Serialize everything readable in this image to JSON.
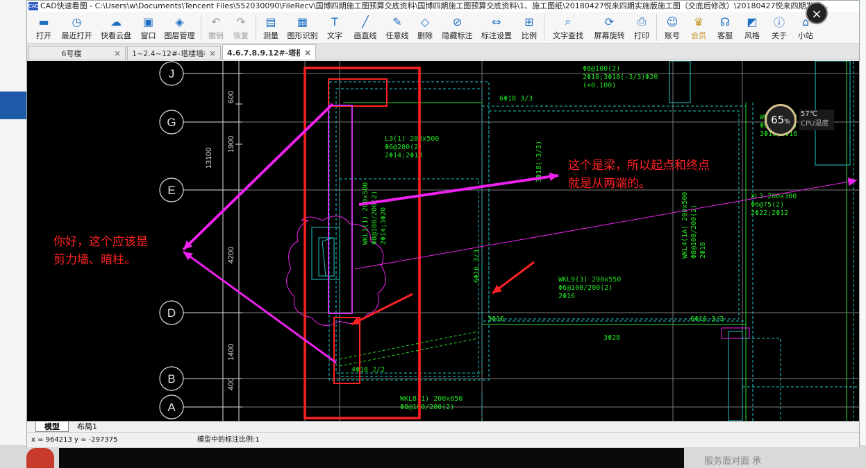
{
  "window": {
    "title": "CAD快速看图 - C:\\Users\\w\\Documents\\Tencent Files\\552030090\\FileRecv\\国博四期施工图预算交底资料\\国博四期施工图预算交底资料\\1、施工图纸\\20180427悦来四期实施版施工图（交底后修改）\\20180427悦来四期发成...",
    "app_icon": "CAD"
  },
  "toolbar": {
    "items": [
      {
        "label": "打开",
        "icon": "folder-open-icon"
      },
      {
        "label": "最近打开",
        "icon": "clock-icon"
      },
      {
        "label": "快看云盘",
        "icon": "cloud-icon"
      },
      {
        "label": "窗口",
        "icon": "window-icon"
      },
      {
        "label": "图层管理",
        "icon": "layers-icon"
      },
      {
        "label": "撤销",
        "icon": "undo-icon",
        "disabled": true
      },
      {
        "label": "恢复",
        "icon": "redo-icon",
        "disabled": true
      },
      {
        "label": "测量",
        "icon": "ruler-icon"
      },
      {
        "label": "图形识别",
        "icon": "shape-recognize-icon"
      },
      {
        "label": "文字",
        "icon": "text-icon"
      },
      {
        "label": "画直线",
        "icon": "line-icon"
      },
      {
        "label": "任意线",
        "icon": "pen-icon"
      },
      {
        "label": "删除",
        "icon": "eraser-icon"
      },
      {
        "label": "隐藏标注",
        "icon": "eye-hide-icon"
      },
      {
        "label": "标注设置",
        "icon": "dimension-settings-icon"
      },
      {
        "label": "比例",
        "icon": "scale-icon"
      },
      {
        "label": "文字查找",
        "icon": "text-search-icon"
      },
      {
        "label": "屏幕旋转",
        "icon": "rotate-screen-icon"
      },
      {
        "label": "打印",
        "icon": "printer-icon"
      },
      {
        "label": "账号",
        "icon": "user-icon"
      },
      {
        "label": "会员",
        "icon": "vip-icon",
        "vip": true
      },
      {
        "label": "客服",
        "icon": "headset-icon"
      },
      {
        "label": "风格",
        "icon": "style-icon"
      },
      {
        "label": "关于",
        "icon": "info-icon"
      },
      {
        "label": "小站",
        "icon": "station-icon"
      }
    ]
  },
  "tabs": [
    {
      "label": "6号楼",
      "active": false
    },
    {
      "label": "1~2.4~12#-塔楼墙柱…",
      "active": false
    },
    {
      "label": "4.6.7.8.9.12#-塔楼…",
      "active": true
    }
  ],
  "close_glyph": "×",
  "tab_close_glyph": "×",
  "drawing": {
    "grid_labels": [
      "J",
      "G",
      "E",
      "D",
      "B",
      "A"
    ],
    "dims": [
      "600",
      "1900",
      "13100",
      "4200",
      "1400",
      "400"
    ],
    "beam_texts": [
      "L3(1) 200x500",
      "Φ6@200(2)",
      "2Φ14;2Φ18",
      "WKL1(1) 200x500",
      "Φ8@100/200(2)",
      "2Φ14;3Φ20",
      "WKL4(1A) 200x500",
      "Φ8@100/200(2)",
      "2Φ18",
      "WKL9(3) 200x550",
      "Φ6@100/200(2)",
      "2Φ16",
      "WKL8(1) 200x650",
      "Φ8@100/200(2)",
      "XL3 200x300",
      "Φ6@75(2)",
      "2Φ22;2Φ12",
      "WKL1(1) 2",
      "Φ8@100(2)",
      "3Φ16;3Φ16",
      "6Φ18 3/3",
      "6Φ16 3/3",
      "3Φ16",
      "3Φ28",
      "6Φ16 3/3",
      "4Φ18 2/2",
      "3Φ18(-3/3)",
      "Φ8@100(2)",
      "2Φ18;3Φ18(-3/3)Φ20",
      "(+0.100)"
    ],
    "annotations": [
      {
        "text_lines": [
          "你好，这个应该是",
          "剪力墙、暗柱。"
        ]
      },
      {
        "text_lines": [
          "这个是梁，所以起点和终点",
          "就是从两端的。"
        ]
      }
    ]
  },
  "layout_tabs": [
    {
      "label": "模型",
      "active": true
    },
    {
      "label": "布局1",
      "active": false
    }
  ],
  "status": {
    "coords": "x = 964213  y = -297375",
    "scale": "模型中的标注比例:1"
  },
  "cpu_widget": {
    "percent": "65",
    "percent_unit": "%",
    "temp": "57℃",
    "label": "CPU温度"
  },
  "desktop_peek_text": "服务面对面 承",
  "colors": {
    "canvas_bg": "#000000",
    "cad_green": "#22e022",
    "cad_cyan": "#20c8c8",
    "annotation_red": "#ff2222",
    "annotation_magenta": "#ee22ee",
    "grid_white": "#e0e0e0"
  }
}
